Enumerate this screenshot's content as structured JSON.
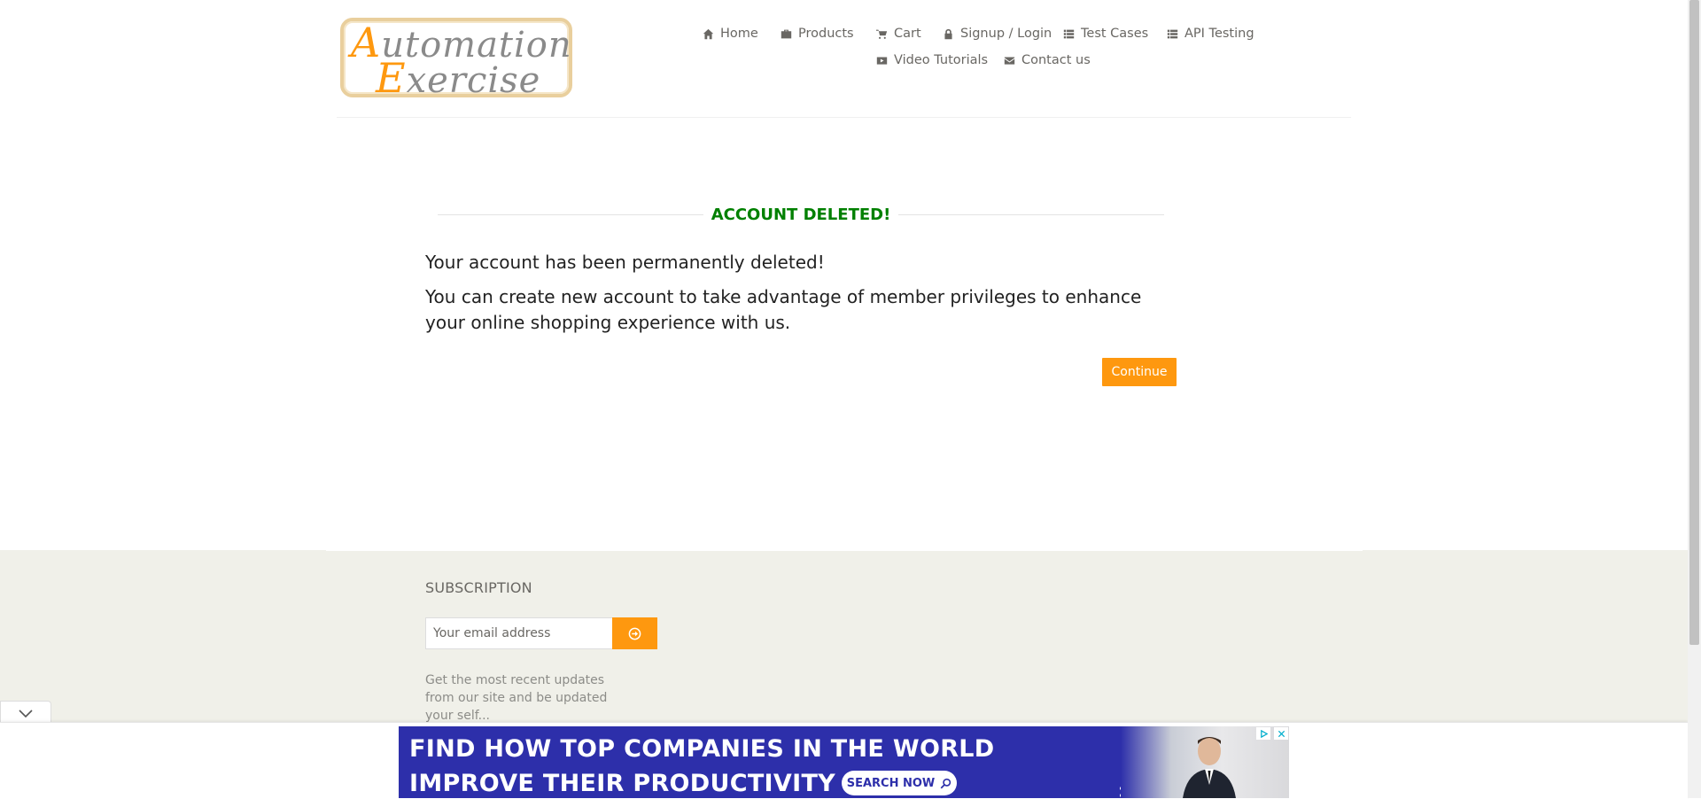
{
  "header": {
    "logo_line1_cap": "A",
    "logo_line1_rest": "utomation",
    "logo_line2_cap": "E",
    "logo_line2_rest": "xercise",
    "nav": [
      {
        "label": "Home",
        "icon": "home-icon"
      },
      {
        "label": "Products",
        "icon": "products-icon"
      },
      {
        "label": "Cart",
        "icon": "cart-icon"
      },
      {
        "label": "Signup / Login",
        "icon": "lock-icon"
      },
      {
        "label": "Test Cases",
        "icon": "list-icon"
      },
      {
        "label": "API Testing",
        "icon": "list-icon"
      },
      {
        "label": "Video Tutorials",
        "icon": "youtube-icon"
      },
      {
        "label": "Contact us",
        "icon": "envelope-icon"
      }
    ]
  },
  "main": {
    "title": "ACCOUNT DELETED!",
    "message1": "Your account has been permanently deleted!",
    "message2": "You can create new account to take advantage of member privileges to enhance your online shopping experience with us.",
    "continue_label": "Continue"
  },
  "footer": {
    "subscription_title": "SUBSCRIPTION",
    "email_placeholder": "Your email address",
    "description": "Get the most recent updates from our site and be updated your self..."
  },
  "ad": {
    "line1": "FIND HOW TOP COMPANIES IN THE WORLD",
    "line2": "IMPROVE THEIR PRODUCTIVITY",
    "search_label": "SEARCH NOW"
  },
  "colors": {
    "accent": "#fe980f",
    "title_green": "#008000",
    "footer_bg": "#f0f0e9",
    "ad_bg": "#2d2faa"
  }
}
